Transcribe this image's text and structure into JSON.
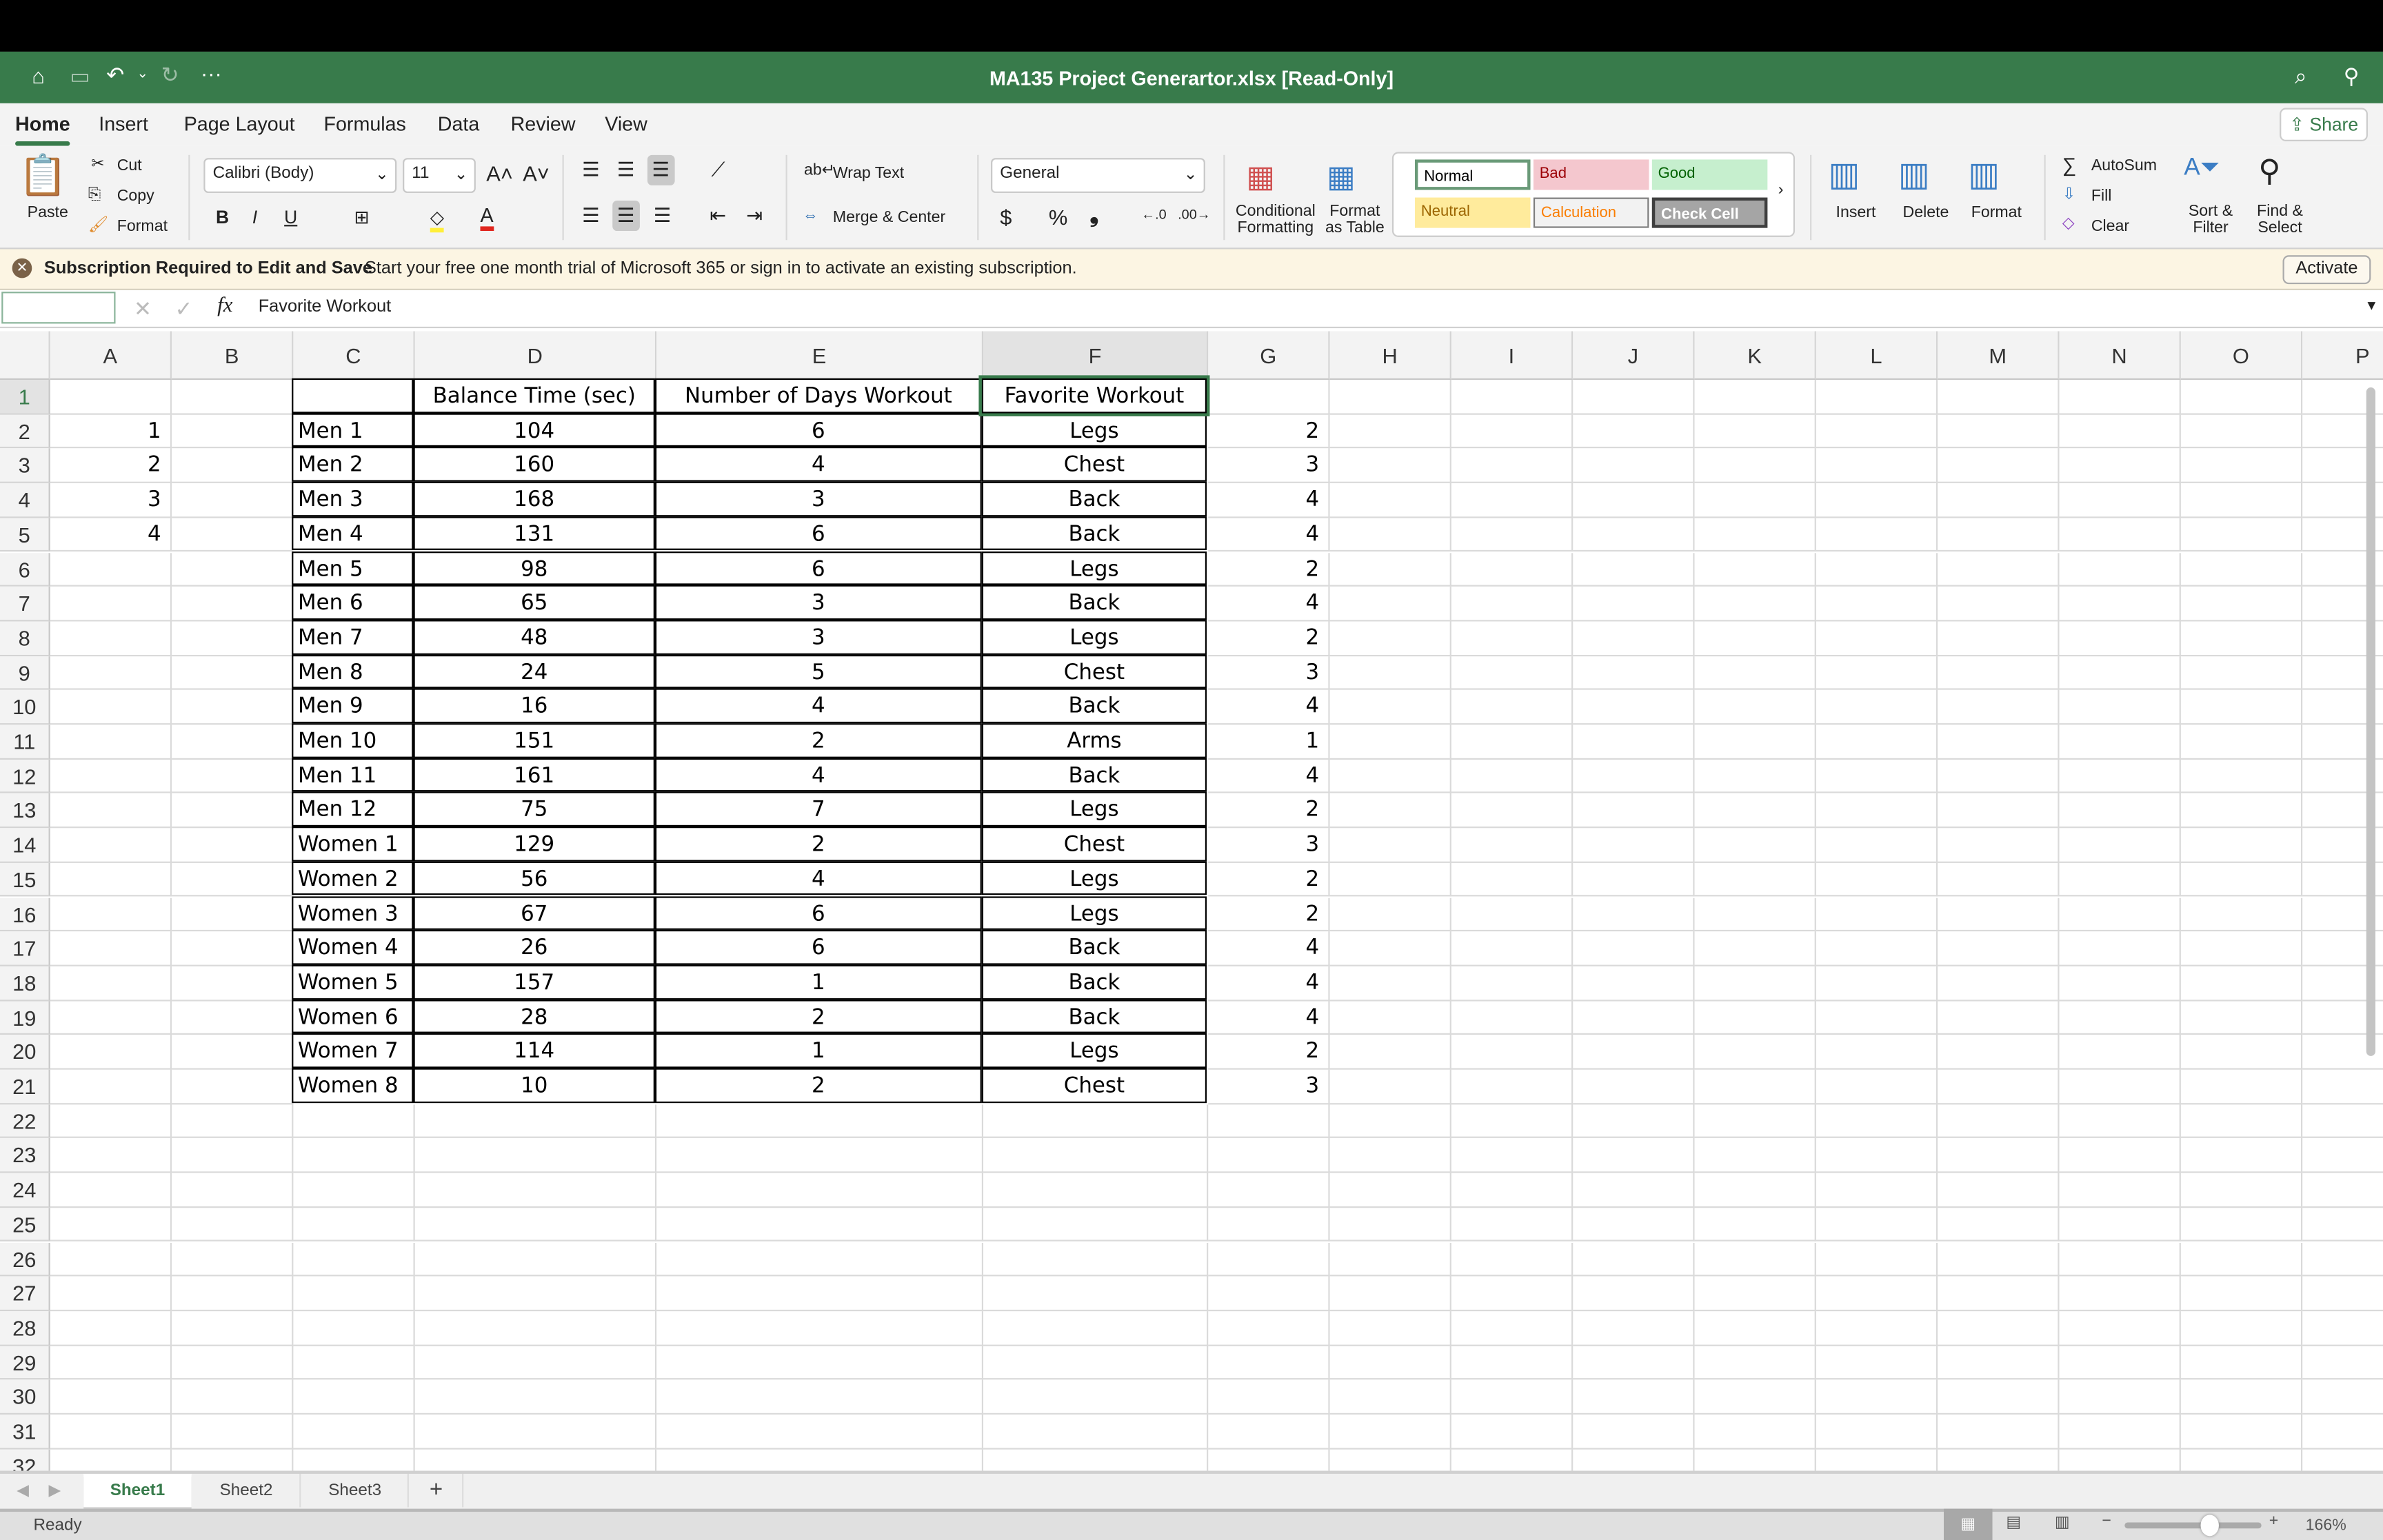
{
  "title": "MA135 Project Generartor.xlsx  [Read-Only]",
  "menu": [
    "Home",
    "Insert",
    "Page Layout",
    "Formulas",
    "Data",
    "Review",
    "View"
  ],
  "share": "Share",
  "ribbon": {
    "paste": "Paste",
    "cut": "Cut",
    "copy": "Copy",
    "format_painter": "Format",
    "font": "Calibri (Body)",
    "size": "11",
    "wrap": "Wrap Text",
    "merge": "Merge & Center",
    "number_format": "General",
    "cond": [
      "Conditional",
      "Formatting"
    ],
    "fmt_table": [
      "Format",
      "as Table"
    ],
    "styles": [
      {
        "label": "Normal",
        "bg": "#ffffff",
        "fg": "#000000"
      },
      {
        "label": "Bad",
        "bg": "#f4c7ce",
        "fg": "#9c0006"
      },
      {
        "label": "Good",
        "bg": "#c6efce",
        "fg": "#006100"
      },
      {
        "label": "Neutral",
        "bg": "#ffeb9c",
        "fg": "#9c6500"
      },
      {
        "label": "Calculation",
        "bg": "#f2f2f2",
        "fg": "#fa7d00"
      },
      {
        "label": "Check Cell",
        "bg": "#a5a5a5",
        "fg": "#ffffff"
      }
    ],
    "insert": "Insert",
    "delete": "Delete",
    "format": "Format",
    "autosum": "AutoSum",
    "fill": "Fill",
    "clear": "Clear",
    "sort": [
      "Sort &",
      "Filter"
    ],
    "find": [
      "Find &",
      "Select"
    ]
  },
  "message": {
    "title": "Subscription Required to Edit and Save",
    "text": "Start your free one month trial of Microsoft 365 or sign in to activate an existing subscription.",
    "button": "Activate"
  },
  "formula_bar": {
    "name_box": "",
    "fx": "fx",
    "value": "Favorite Workout"
  },
  "columns": [
    "A",
    "B",
    "C",
    "D",
    "E",
    "F",
    "G",
    "H",
    "I",
    "J",
    "K",
    "L",
    "M",
    "N",
    "O",
    "P"
  ],
  "selected_cell": "F1",
  "header_row": {
    "C": "",
    "D": "Balance Time (sec)",
    "E": "Number of Days Workout",
    "F": "Favorite Workout"
  },
  "rows": [
    {
      "A": "1",
      "C": "Men 1",
      "D": "104",
      "E": "6",
      "F": "Legs",
      "G": "2"
    },
    {
      "A": "2",
      "C": "Men 2",
      "D": "160",
      "E": "4",
      "F": "Chest",
      "G": "3"
    },
    {
      "A": "3",
      "C": "Men 3",
      "D": "168",
      "E": "3",
      "F": "Back",
      "G": "4"
    },
    {
      "A": "4",
      "C": "Men 4",
      "D": "131",
      "E": "6",
      "F": "Back",
      "G": "4"
    },
    {
      "C": "Men 5",
      "D": "98",
      "E": "6",
      "F": "Legs",
      "G": "2"
    },
    {
      "C": "Men 6",
      "D": "65",
      "E": "3",
      "F": "Back",
      "G": "4"
    },
    {
      "C": "Men 7",
      "D": "48",
      "E": "3",
      "F": "Legs",
      "G": "2"
    },
    {
      "C": "Men 8",
      "D": "24",
      "E": "5",
      "F": "Chest",
      "G": "3"
    },
    {
      "C": "Men 9",
      "D": "16",
      "E": "4",
      "F": "Back",
      "G": "4"
    },
    {
      "C": "Men 10",
      "D": "151",
      "E": "2",
      "F": "Arms",
      "G": "1"
    },
    {
      "C": "Men 11",
      "D": "161",
      "E": "4",
      "F": "Back",
      "G": "4"
    },
    {
      "C": "Men 12",
      "D": "75",
      "E": "7",
      "F": "Legs",
      "G": "2"
    },
    {
      "C": "Women 1",
      "D": "129",
      "E": "2",
      "F": "Chest",
      "G": "3"
    },
    {
      "C": "Women 2",
      "D": "56",
      "E": "4",
      "F": "Legs",
      "G": "2"
    },
    {
      "C": "Women 3",
      "D": "67",
      "E": "6",
      "F": "Legs",
      "G": "2"
    },
    {
      "C": "Women 4",
      "D": "26",
      "E": "6",
      "F": "Back",
      "G": "4"
    },
    {
      "C": "Women 5",
      "D": "157",
      "E": "1",
      "F": "Back",
      "G": "4"
    },
    {
      "C": "Women 6",
      "D": "28",
      "E": "2",
      "F": "Back",
      "G": "4"
    },
    {
      "C": "Women 7",
      "D": "114",
      "E": "1",
      "F": "Legs",
      "G": "2"
    },
    {
      "C": "Women 8",
      "D": "10",
      "E": "2",
      "F": "Chest",
      "G": "3"
    }
  ],
  "row_numbers": [
    "1",
    "2",
    "3",
    "4",
    "5",
    "6",
    "7",
    "8",
    "9",
    "10",
    "11",
    "12",
    "13",
    "14",
    "15",
    "16",
    "17",
    "18",
    "19",
    "20",
    "21",
    "22",
    "23",
    "24",
    "25",
    "26",
    "27",
    "28",
    "29",
    "30",
    "31",
    "32"
  ],
  "sheets": [
    "Sheet1",
    "Sheet2",
    "Sheet3"
  ],
  "active_sheet": "Sheet1",
  "add_sheet": "+",
  "status": "Ready",
  "zoom": "166%",
  "zoom_percent": 166,
  "accent": "#387b4b"
}
